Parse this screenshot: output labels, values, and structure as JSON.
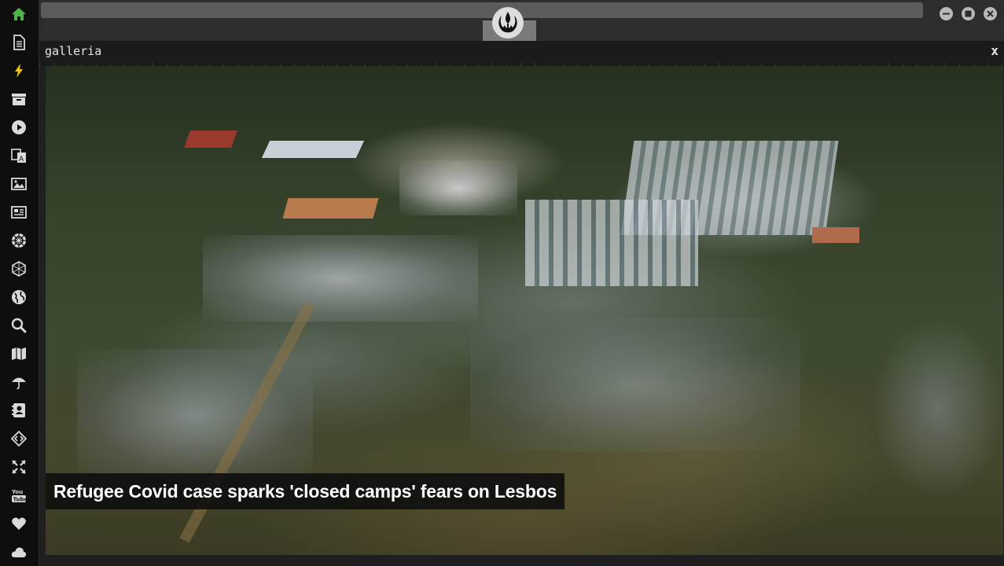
{
  "app": {
    "emblem": "rebel-alliance-emblem",
    "window_controls": [
      "minimize-icon",
      "maximize-icon",
      "close-icon"
    ]
  },
  "sidebar": {
    "items": [
      {
        "icon": "home-icon",
        "color": "#4fb34a"
      },
      {
        "icon": "document-icon",
        "color": "#d9d9d9"
      },
      {
        "icon": "lightning-icon",
        "color": "#f0c419"
      },
      {
        "icon": "archive-icon",
        "color": "#d9d9d9"
      },
      {
        "icon": "play-icon",
        "color": "#d9d9d9"
      },
      {
        "icon": "translate-icon",
        "color": "#d9d9d9"
      },
      {
        "icon": "image-icon",
        "color": "#d9d9d9"
      },
      {
        "icon": "newspaper-icon",
        "color": "#d9d9d9"
      },
      {
        "icon": "galactic-empire-icon",
        "color": "#d9d9d9"
      },
      {
        "icon": "hexagon-icon",
        "color": "#d9d9d9"
      },
      {
        "icon": "globe-icon",
        "color": "#d9d9d9"
      },
      {
        "icon": "search-icon",
        "color": "#d9d9d9"
      },
      {
        "icon": "map-icon",
        "color": "#d9d9d9"
      },
      {
        "icon": "umbrella-icon",
        "color": "#d9d9d9"
      },
      {
        "icon": "contact-book-icon",
        "color": "#d9d9d9"
      },
      {
        "icon": "code-icon",
        "color": "#d9d9d9"
      },
      {
        "icon": "expand-arrows-icon",
        "color": "#d9d9d9"
      },
      {
        "icon": "youtube-icon",
        "color": "#d9d9d9"
      },
      {
        "icon": "heart-icon",
        "color": "#d9d9d9"
      },
      {
        "icon": "cloud-icon",
        "color": "#d9d9d9"
      }
    ]
  },
  "panel": {
    "title": "galleria",
    "close_label": "x"
  },
  "gallery": {
    "caption": "Refugee Covid case sparks 'closed camps' fears on Lesbos"
  }
}
